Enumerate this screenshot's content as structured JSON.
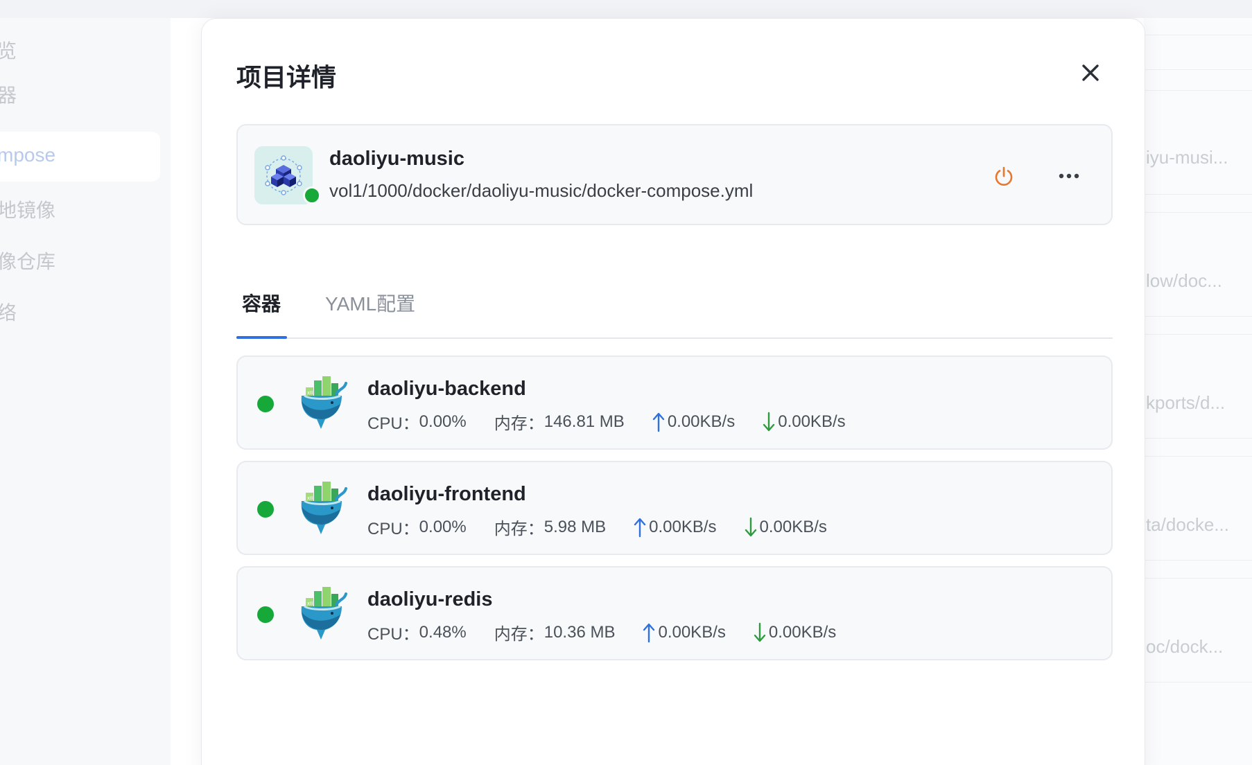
{
  "sidebar": {
    "items": [
      {
        "label": "览"
      },
      {
        "label": "器"
      },
      {
        "label": "mpose"
      },
      {
        "label": "地镜像"
      },
      {
        "label": "像仓库"
      },
      {
        "label": "络"
      }
    ]
  },
  "background_list": {
    "items": [
      {
        "text": "iyu-musi..."
      },
      {
        "text": "low/doc..."
      },
      {
        "text": "kports/d..."
      },
      {
        "text": "ta/docke..."
      },
      {
        "text": "oc/dock..."
      }
    ]
  },
  "modal": {
    "title": "项目详情",
    "project": {
      "name": "daoliyu-music",
      "path": "vol1/1000/docker/daoliyu-music/docker-compose.yml",
      "status": "running"
    },
    "tabs": [
      {
        "label": "容器",
        "active": true
      },
      {
        "label": "YAML配置",
        "active": false
      }
    ],
    "containers": [
      {
        "name": "daoliyu-backend",
        "cpu_label": "CPU：",
        "cpu": "0.00%",
        "mem_label": "内存：",
        "mem": "146.81 MB",
        "up": "0.00KB/s",
        "down": "0.00KB/s"
      },
      {
        "name": "daoliyu-frontend",
        "cpu_label": "CPU：",
        "cpu": "0.00%",
        "mem_label": "内存：",
        "mem": "5.98 MB",
        "up": "0.00KB/s",
        "down": "0.00KB/s"
      },
      {
        "name": "daoliyu-redis",
        "cpu_label": "CPU：",
        "cpu": "0.48%",
        "mem_label": "内存：",
        "mem": "10.36 MB",
        "up": "0.00KB/s",
        "down": "0.00KB/s"
      }
    ]
  },
  "colors": {
    "accent": "#2f6fe0",
    "running": "#17a83a",
    "power": "#e8772e",
    "upload": "#2f6fe0",
    "download": "#2e9a3e"
  }
}
